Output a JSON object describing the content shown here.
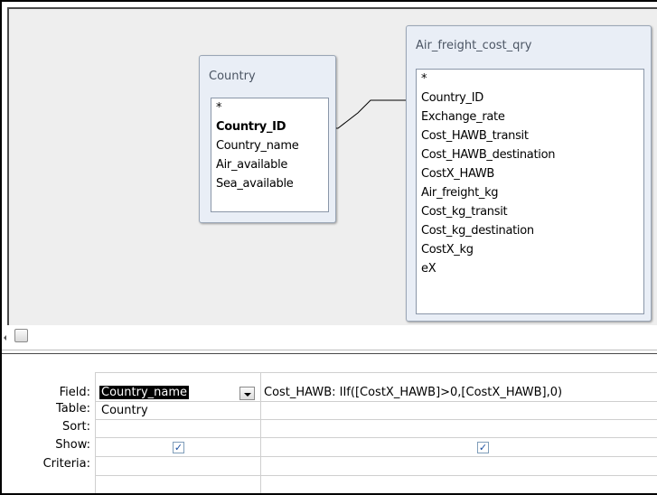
{
  "tables": {
    "country": {
      "title": "Country",
      "fields": [
        "*",
        "Country_ID",
        "Country_name",
        "Air_available",
        "Sea_available"
      ]
    },
    "air_freight": {
      "title": "Air_freight_cost_qry",
      "fields": [
        "*",
        "Country_ID",
        "Exchange_rate",
        "Cost_HAWB_transit",
        "Cost_HAWB_destination",
        "CostX_HAWB",
        "Air_freight_kg",
        "Cost_kg_transit",
        "Cost_kg_destination",
        "CostX_kg",
        "eX"
      ]
    }
  },
  "grid": {
    "row_headers": {
      "field": "Field:",
      "table": "Table:",
      "sort": "Sort:",
      "show": "Show:",
      "criteria": "Criteria:"
    },
    "col1": {
      "field": "Country_name",
      "table": "Country",
      "show": "✓"
    },
    "col2": {
      "field": "Cost_HAWB: IIf([CostX_HAWB]>0,[CostX_HAWB],0)",
      "table": "",
      "show": "✓"
    }
  }
}
